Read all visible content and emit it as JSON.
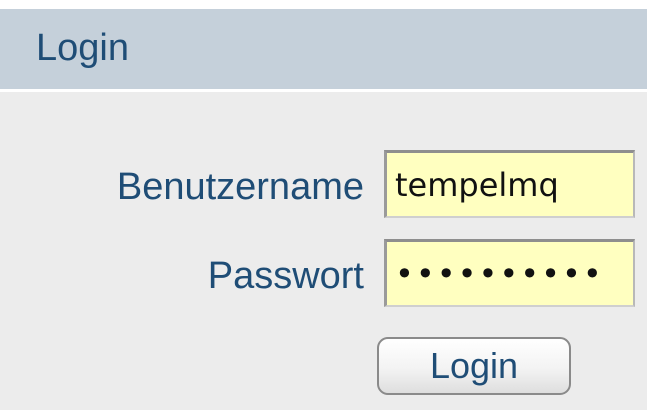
{
  "login_panel": {
    "title": "Login",
    "username_label": "Benutzername",
    "username_value": "tempelmq",
    "password_label": "Passwort",
    "password_value": "••••••••••",
    "submit_label": "Login"
  },
  "colors": {
    "header_background": "#c5d0da",
    "panel_background": "#ececec",
    "text_accent": "#1f4d76",
    "input_background": "#ffffc0"
  }
}
